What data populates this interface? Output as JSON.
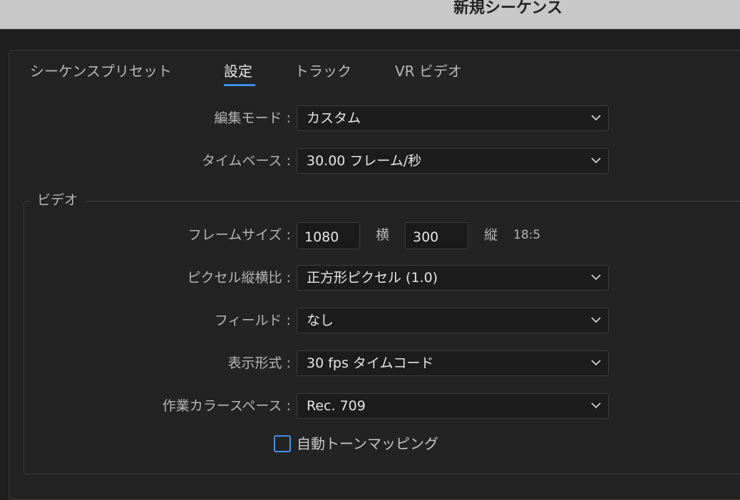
{
  "window": {
    "title": "新規シーケンス"
  },
  "tabs": [
    {
      "label": "シーケンスプリセット",
      "active": false
    },
    {
      "label": "設定",
      "active": true
    },
    {
      "label": "トラック",
      "active": false
    },
    {
      "label": "VR ビデオ",
      "active": false
    }
  ],
  "settings": {
    "editing_mode": {
      "label": "編集モード :",
      "value": "カスタム"
    },
    "timebase": {
      "label": "タイムベース :",
      "value": "30.00  フレーム/秒"
    }
  },
  "video": {
    "legend": "ビデオ",
    "frame_size": {
      "label": "フレームサイズ :",
      "width": "1080",
      "width_unit": "横",
      "height": "300",
      "height_unit": "縦",
      "ratio": "18:5"
    },
    "pixel_aspect": {
      "label": "ピクセル縦横比 :",
      "value": "正方形ピクセル (1.0)"
    },
    "fields": {
      "label": "フィールド :",
      "value": "なし"
    },
    "display_format": {
      "label": "表示形式 :",
      "value": "30 fps タイムコード"
    },
    "color_space": {
      "label": "作業カラースペース :",
      "value": "Rec. 709"
    },
    "auto_tone_mapping": {
      "label": "自動トーンマッピング",
      "checked": false
    }
  },
  "icons": {
    "dropdown": "chevron-down-icon"
  },
  "colors": {
    "accent": "#3f8cf0",
    "checkbox_border": "#4a90e2",
    "background": "#232323"
  }
}
